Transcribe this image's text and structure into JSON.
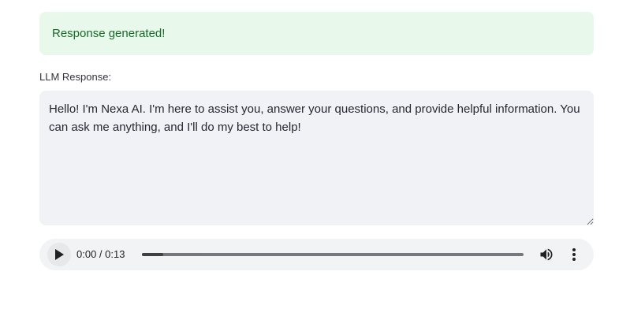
{
  "alert": {
    "message": "Response generated!",
    "color": "#17692a",
    "background": "#e8f8ea"
  },
  "response": {
    "label": "LLM Response:",
    "text": "Hello! I'm Nexa AI. I'm here to assist you, answer your questions, and provide helpful information. You can ask me anything, and I'll do my best to help!"
  },
  "audio": {
    "time": "0:00 / 0:13",
    "progress": 0.055,
    "icons": {
      "play": "play-icon",
      "volume": "volume-icon",
      "more": "more-vertical-icon"
    }
  }
}
